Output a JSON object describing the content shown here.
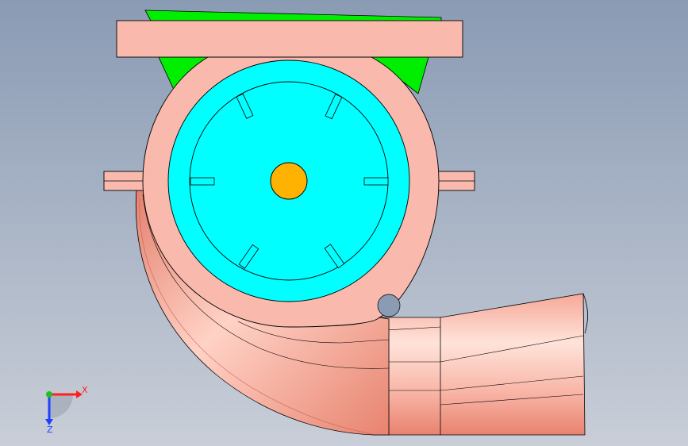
{
  "viewport": {
    "background_top": "#8a9bb4",
    "background_bottom": "#c9ced8"
  },
  "colors": {
    "housing": "#f9b9ad",
    "housing_dark": "#e07a6a",
    "outline": "#000000",
    "impeller_disc": "#00ffff",
    "shaft": "#ffb300",
    "gusset": "#00ee00"
  },
  "triad": {
    "x_label": "X",
    "z_label": "Z",
    "x_color": "#ff2020",
    "y_color": "#20c020",
    "z_color": "#2040ff"
  }
}
